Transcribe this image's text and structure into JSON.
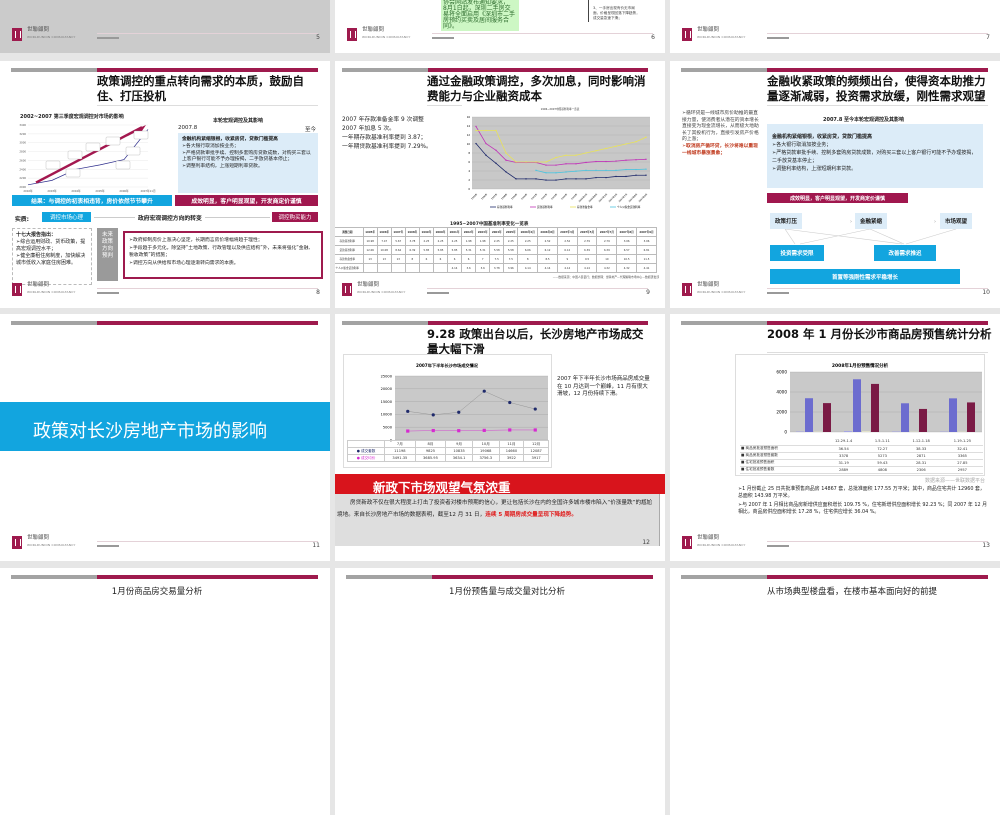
{
  "colors": {
    "maroon": "#9e1a4d",
    "blue": "#12a5df",
    "red": "#d8141c",
    "gray": "#a3a3a3"
  },
  "common": {
    "logo_text": "世聯顧問",
    "logo_sub": "WORLDUNION CONSULTANCY"
  },
  "slides": {
    "s5": {
      "page": "5"
    },
    "s6": {
      "page": "6",
      "green_lines": [
        "协会网站发布通知要求，",
        "8月1日起，深圳二手房交",
        "易将全面启用《深圳市二手",
        "房预约买卖及居间服务合",
        "同》。"
      ],
      "right_lines": [
        "3、一手房出现有价无市局",
        "面，价格呈现回落下降趋势，",
        "成交量急速下滑；"
      ]
    },
    "s7": {
      "page": "7"
    },
    "s8": {
      "page": "8",
      "title": "政策调控的重点转向需求的本质，鼓励自住、打压投机",
      "chart_title": "2002~2007 第三季度宏观调控对市场的影响",
      "right_title": "本轮宏观调控及其影响",
      "date_from": "2007.8",
      "date_to": "至今",
      "box_head": "金融机构紧缩银根，收紧房贷，贷款门槛提高",
      "box_items": [
        "➢各大银行取消加按业务；",
        "➢严格贷款审批手续、控制多套购房贷款成数，对购买三套以上客户银行可能不予办理按揭，二手放贷基本停止；",
        "➢调整利率结构，上涨短期利率贷款。"
      ],
      "result_left": "结果：与调控的初衷相违背，房价依然节节攀升",
      "result_right": "成效明显，客户明显观望，开发商定价谨慎",
      "essence_label": "实质:",
      "essence_left": "调控市场心理",
      "essence_center": "政府宏观调控方向的转变",
      "essence_right": "调控购买能力",
      "left_head": "十七大报告指出：",
      "left_items": [
        "➢综合运用财政、货币政策，提高宏观调控水平；",
        "➢健全廉租住房制度，加快解决城市低收入家庭住房困难。"
      ],
      "future_label": "未来政策方向预判",
      "future_items": [
        "➢政府抑制房价上涨决心坚定，长期而言房价增幅将趋于理性；",
        "➢手段趋于多元化，除坚持“土地政策、行政管理以及供应结构”外，未来将强化“金融、税收政策”的措施；",
        "➢调控方向从供给和市场心理逐渐转向需求的本质。"
      ]
    },
    "s9": {
      "page": "9",
      "title": "通过金融政策调控，多次加息，同时影响消费能力与企业融资成本",
      "left_lines": [
        "2007 年存款准备金率 9 次调整",
        "2007 年加息 5 次。",
        "一年期存款基准利率提到 3.87；",
        "一年期贷款基准利率提到 7.29%。"
      ],
      "table_title": "1995~2007中国基准利率变化一览表",
      "table_source": "——数据来源：中国人民银行；数据整理：世联地产—代理策略市场中心—数据研发部"
    },
    "s10": {
      "page": "10",
      "title": "金融收紧政策的频频出台，使得资本助推力量逐渐减弱，投资需求放缓，刚性需求观望",
      "left_text": "➢循环贷是一线城市房价助推的最直接力量，使消费者从潜在的资本增长直接变为现金流增长，从而极大地助长了其投机行为，直接引发房产价格的上涨；",
      "left_red": "➢取消房产循环贷，长沙将难以重现一线城市暴涨景象；",
      "sub_title": "2007.8 至今本轮宏观调控及其影响",
      "box_head": "金融机构紧缩银根，收紧房贷，贷款门槛提高",
      "box_items": [
        "➢各大银行取消加按业务；",
        "➢严格贷款审批手续、控制多套购房贷款成数，对购买三套以上客户银行可能不予办理按揭，二手放贷基本停止；",
        "➢调整利率结构，上涨短期利率贷款。"
      ],
      "red_bar": "成效明显，客户明显观望，开发商定价谨慎",
      "flow": [
        "政策打压",
        "金融紧缩",
        "市场观望"
      ],
      "effects": [
        "投资需求受限",
        "改善需求推迟"
      ],
      "bottom_bar": "首置等强刚性需求平稳增长"
    },
    "s11": {
      "page": "11",
      "banner": "政策对长沙房地产市场的影响"
    },
    "s12": {
      "page": "12",
      "title": "9.28 政策出台以后，长沙房地产市场成交量大幅下滑",
      "right_text": "2007 年下半年长沙市场商品房成交量在 10 月达到一个巅峰，11 月有很大滑坡，12 月份持续下滑。",
      "red_banner": "新政下市场观望气氛浓重",
      "para": "房贷新政不仅在很大程度上打击了投资者对楼市预期的信心，更让包括长沙在内的全国许多城市楼市陷入“价涨量跌”的尴尬境地。来自长沙房地产市场的数据表明，截至12 月 31 日，",
      "para_red": "连续 5 周期房成交量呈现下降趋势。"
    },
    "s13": {
      "page": "13",
      "title": "2008 年 1 月份长沙市商品房预售统计分析",
      "source": "数据来源——世联数据平台",
      "bullets": [
        "➢1 月份截止 25 日共批准预售商品房 14867 套，总批准面积 177.55 万平米；其中，商品住宅共计 12960 套，总面积 143.98 万平米。",
        "➢与 2007 年 1 月相比商品房新增供应面积增长 109.75 %，住宅新增供应面积增长 92.23 %；同 2007 年 12 月相比，商品房供应面积增长 17.28 %，住宅供应增长 36.04 %。"
      ]
    },
    "s14": {
      "title": "1月份商品房交易量分析"
    },
    "s15": {
      "title": "1月份预售量与成交量对比分析"
    },
    "s16": {
      "title": "从市场典型楼盘看，在楼市基本面向好的前提"
    }
  },
  "chart_data": [
    {
      "id": "s8-chart",
      "type": "line",
      "title": "2002~2007 第三季度宏观调控对市场的影响",
      "categories": [
        "2002年",
        "2003年",
        "2004年",
        "2005年",
        "2006年",
        "2007年11月"
      ],
      "ylim": [
        2000,
        3400
      ],
      "yticks": [
        2000,
        2200,
        2400,
        2600,
        2800,
        3000,
        3200,
        3400
      ],
      "values": [
        2050,
        2150,
        2400,
        2500,
        2620,
        3300
      ]
    },
    {
      "id": "s9-chart",
      "type": "line",
      "title": "1996~2007中国基准利率一览表",
      "ylim": [
        0,
        16
      ],
      "yticks": [
        0,
        2,
        4,
        6,
        8,
        10,
        12,
        14,
        16
      ],
      "series": [
        {
          "name": "存款基准利率",
          "color": "#1f2a6b",
          "values": [
            10.1,
            7.5,
            5.7,
            3.8,
            2.25,
            2.25,
            2.25,
            1.98,
            1.98,
            2.25,
            2.25,
            2.25,
            2.52,
            2.52,
            2.79,
            2.79,
            3.06,
            3.06
          ]
        },
        {
          "name": "贷款基准利率",
          "color": "#c036b8",
          "values": [
            13.9,
            10.1,
            8.6,
            6.4,
            5.9,
            5.9,
            5.9,
            5.3,
            5.3,
            5.6,
            5.6,
            5.9,
            6.1,
            6.1,
            6.2,
            6.4,
            6.5,
            6.6
          ]
        },
        {
          "name": "存款准备金率",
          "color": "#e8e25a",
          "values": [
            13,
            13,
            13,
            8,
            6,
            6,
            6,
            6,
            7,
            7.5,
            7.5,
            8,
            8.5,
            9,
            9.5,
            10,
            10.5,
            11.5
          ]
        },
        {
          "name": "个人公积金贷款利率",
          "color": "#4fc4de",
          "values": [
            null,
            null,
            null,
            null,
            null,
            null,
            4.14,
            3.6,
            3.6,
            3.78,
            3.96,
            4.14,
            4.14,
            4.14,
            4.14,
            4.32,
            4.32,
            4.41
          ]
        }
      ],
      "table": {
        "header": [
          "调整日期",
          "1995年",
          "1996年",
          "1997年",
          "1998年",
          "1999年",
          "2000年",
          "2001年",
          "2002年",
          "2003年",
          "2004年",
          "2005年",
          "2006年4月",
          "2006年8月",
          "2007年3月",
          "2007年5月",
          "2007年7月",
          "2007年8月",
          "2007年9月"
        ],
        "rows": [
          [
            "存款基准利率",
            "10.98",
            "7.47",
            "5.67",
            "3.78",
            "2.25",
            "2.25",
            "2.25",
            "1.98",
            "1.98",
            "2.25",
            "2.25",
            "2.25",
            "2.52",
            "2.52",
            "2.79",
            "2.79",
            "3.06",
            "3.06"
          ],
          [
            "贷款基准利率",
            "12.06",
            "10.08",
            "8.64",
            "6.39",
            "5.85",
            "5.85",
            "5.85",
            "5.31",
            "5.31",
            "5.58",
            "5.58",
            "6.06",
            "6.12",
            "6.12",
            "6.39",
            "6.39",
            "6.57",
            "6.81"
          ],
          [
            "存款准备金率",
            "13",
            "13",
            "13",
            "8",
            "6",
            "6",
            "6",
            "6",
            "7",
            "7.5",
            "7.5",
            "8",
            "8.5",
            "9",
            "9.5",
            "10",
            "10.5",
            "11.5"
          ],
          [
            "个人公积金贷款利率",
            "",
            "",
            "",
            "",
            "",
            "",
            "4.14",
            "3.6",
            "3.6",
            "3.78",
            "3.96",
            "4.14",
            "4.14",
            "4.14",
            "4.14",
            "4.32",
            "4.32",
            "4.41"
          ]
        ]
      }
    },
    {
      "id": "s12-chart",
      "type": "line",
      "title": "2007年下半年长沙市场成交情况",
      "categories": [
        "7月",
        "8月",
        "9月",
        "10月",
        "11月",
        "12月"
      ],
      "ylim": [
        0,
        25000
      ],
      "yticks": [
        0,
        5000,
        10000,
        15000,
        20000,
        25000
      ],
      "series": [
        {
          "name": "成交套数",
          "color": "#1f2a6b",
          "values": [
            11198,
            9825,
            10835,
            19068,
            14660,
            12087
          ],
          "labels": [
            "11198",
            "9825",
            "10835",
            "19068",
            "14660",
            "12087"
          ]
        },
        {
          "name": "成交均价",
          "color": "#d62bd0",
          "values": [
            3491.35,
            3685.95,
            3634.1,
            3756.3,
            3922,
            3917
          ],
          "labels": [
            "3491.35",
            "3685.95",
            "3634.1",
            "3756.3",
            "3922",
            "3917"
          ]
        }
      ]
    },
    {
      "id": "s13-chart",
      "type": "bar",
      "title": "2008年1月份预售情况分析",
      "categories": [
        "12.29-1.4",
        "1.5-1.11",
        "1.12-1.18",
        "1.19-1.25"
      ],
      "ylim": [
        0,
        6000
      ],
      "yticks": [
        0,
        2000,
        4000,
        6000
      ],
      "series": [
        {
          "name": "商品房批准预售面积",
          "color": "#9999ee",
          "values": [
            36.54,
            72.27,
            38.33,
            32.41
          ],
          "labels": [
            "36.54",
            "72.27",
            "38.33",
            "32.41"
          ]
        },
        {
          "name": "商品房批准预售套数",
          "color": "#6c6ccf",
          "values": [
            3378,
            5273,
            2871,
            3365
          ],
          "labels": [
            "3378",
            "5273",
            "2871",
            "3365"
          ]
        },
        {
          "name": "住宅批准预售面积",
          "color": "#f3f3cc",
          "values": [
            31.19,
            59.43,
            28.31,
            27.85
          ],
          "labels": [
            "31.19",
            "59.43",
            "28.31",
            "27.85"
          ]
        },
        {
          "name": "住宅批准预售套数",
          "color": "#7a1a45",
          "values": [
            2889,
            4808,
            2306,
            2957
          ],
          "labels": [
            "2889",
            "4808",
            "2306",
            "2957"
          ]
        }
      ]
    }
  ]
}
